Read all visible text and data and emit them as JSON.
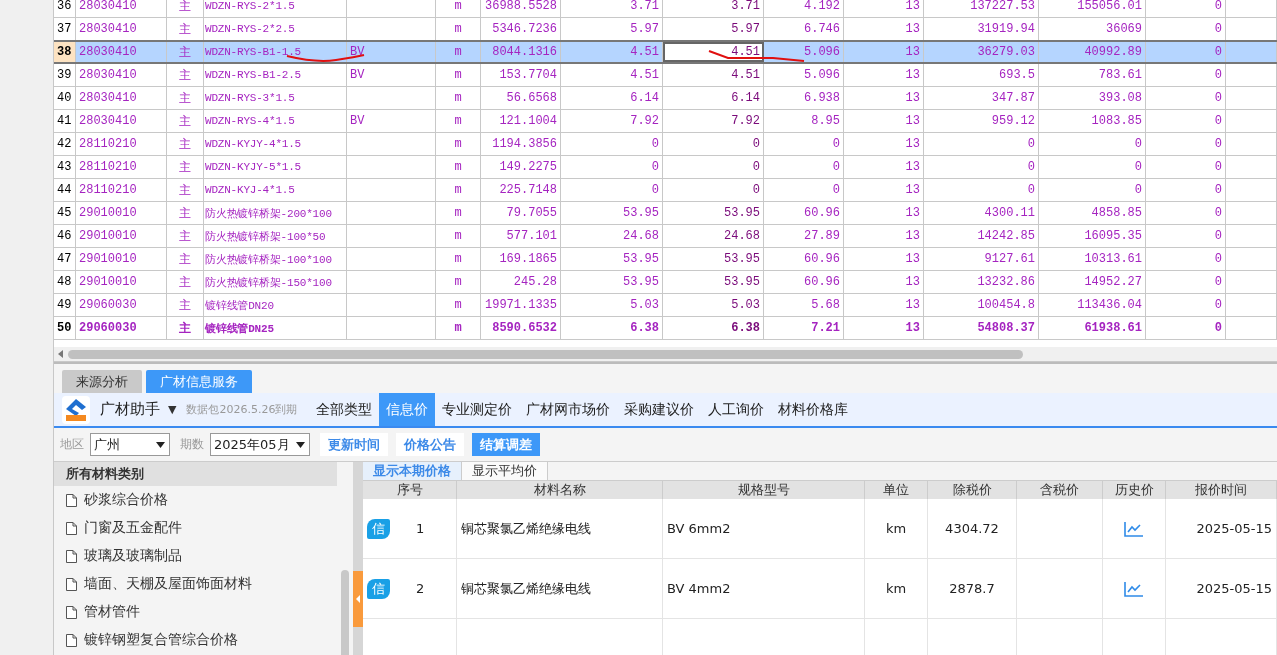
{
  "grid": {
    "rows": [
      {
        "cells": [
          "36",
          "28030410",
          "主",
          "WDZN-RYS-2*1.5",
          "",
          "m",
          "36988.5528",
          "3.71",
          "3.71",
          "4.192",
          "13",
          "137227.53",
          "155056.01",
          "0"
        ],
        "selected": false,
        "bold": false
      },
      {
        "cells": [
          "37",
          "28030410",
          "主",
          "WDZN-RYS-2*2.5",
          "",
          "m",
          "5346.7236",
          "5.97",
          "5.97",
          "6.746",
          "13",
          "31919.94",
          "36069",
          "0"
        ],
        "selected": false,
        "bold": false
      },
      {
        "cells": [
          "38",
          "28030410",
          "主",
          "WDZN-RYS-B1-1.5",
          "BV",
          "m",
          "8044.1316",
          "4.51",
          "4.51",
          "5.096",
          "13",
          "36279.03",
          "40992.89",
          "0"
        ],
        "selected": true,
        "bold": false
      },
      {
        "cells": [
          "39",
          "28030410",
          "主",
          "WDZN-RYS-B1-2.5",
          "BV",
          "m",
          "153.7704",
          "4.51",
          "4.51",
          "5.096",
          "13",
          "693.5",
          "783.61",
          "0"
        ],
        "selected": false,
        "bold": false
      },
      {
        "cells": [
          "40",
          "28030410",
          "主",
          "WDZN-RYS-3*1.5",
          "",
          "m",
          "56.6568",
          "6.14",
          "6.14",
          "6.938",
          "13",
          "347.87",
          "393.08",
          "0"
        ],
        "selected": false,
        "bold": false
      },
      {
        "cells": [
          "41",
          "28030410",
          "主",
          "WDZN-RYS-4*1.5",
          "BV",
          "m",
          "121.1004",
          "7.92",
          "7.92",
          "8.95",
          "13",
          "959.12",
          "1083.85",
          "0"
        ],
        "selected": false,
        "bold": false
      },
      {
        "cells": [
          "42",
          "28110210",
          "主",
          "WDZN-KYJY-4*1.5",
          "",
          "m",
          "1194.3856",
          "0",
          "0",
          "0",
          "13",
          "0",
          "0",
          "0"
        ],
        "selected": false,
        "bold": false
      },
      {
        "cells": [
          "43",
          "28110210",
          "主",
          "WDZN-KYJY-5*1.5",
          "",
          "m",
          "149.2275",
          "0",
          "0",
          "0",
          "13",
          "0",
          "0",
          "0"
        ],
        "selected": false,
        "bold": false
      },
      {
        "cells": [
          "44",
          "28110210",
          "主",
          "WDZN-KYJ-4*1.5",
          "",
          "m",
          "225.7148",
          "0",
          "0",
          "0",
          "13",
          "0",
          "0",
          "0"
        ],
        "selected": false,
        "bold": false
      },
      {
        "cells": [
          "45",
          "29010010",
          "主",
          "防火热镀锌桥架-200*100",
          "",
          "m",
          "79.7055",
          "53.95",
          "53.95",
          "60.96",
          "13",
          "4300.11",
          "4858.85",
          "0"
        ],
        "selected": false,
        "bold": false
      },
      {
        "cells": [
          "46",
          "29010010",
          "主",
          "防火热镀锌桥架-100*50",
          "",
          "m",
          "577.101",
          "24.68",
          "24.68",
          "27.89",
          "13",
          "14242.85",
          "16095.35",
          "0"
        ],
        "selected": false,
        "bold": false
      },
      {
        "cells": [
          "47",
          "29010010",
          "主",
          "防火热镀锌桥架-100*100",
          "",
          "m",
          "169.1865",
          "53.95",
          "53.95",
          "60.96",
          "13",
          "9127.61",
          "10313.61",
          "0"
        ],
        "selected": false,
        "bold": false
      },
      {
        "cells": [
          "48",
          "29010010",
          "主",
          "防火热镀锌桥架-150*100",
          "",
          "m",
          "245.28",
          "53.95",
          "53.95",
          "60.96",
          "13",
          "13232.86",
          "14952.27",
          "0"
        ],
        "selected": false,
        "bold": false
      },
      {
        "cells": [
          "49",
          "29060030",
          "主",
          "镀锌线管DN20",
          "",
          "m",
          "19971.1335",
          "5.03",
          "5.03",
          "5.68",
          "13",
          "100454.8",
          "113436.04",
          "0"
        ],
        "selected": false,
        "bold": false
      },
      {
        "cells": [
          "50",
          "29060030",
          "主",
          "镀锌线管DN25",
          "",
          "m",
          "8590.6532",
          "6.38",
          "6.38",
          "7.21",
          "13",
          "54808.37",
          "61938.61",
          "0"
        ],
        "selected": false,
        "bold": true
      }
    ]
  },
  "bottom_tabs": [
    {
      "label": "来源分析",
      "selected": false
    },
    {
      "label": "广材信息服务",
      "selected": true
    }
  ],
  "toolbar": {
    "title": "广材助手",
    "caret": "▼",
    "note": "数据包2026.5.26到期",
    "nav": [
      {
        "label": "全部类型",
        "selected": false
      },
      {
        "label": "信息价",
        "selected": true
      },
      {
        "label": "专业测定价",
        "selected": false
      },
      {
        "label": "广材网市场价",
        "selected": false
      },
      {
        "label": "采购建议价",
        "selected": false
      },
      {
        "label": "人工询价",
        "selected": false
      },
      {
        "label": "材料价格库",
        "selected": false
      }
    ]
  },
  "filters": {
    "region_label": "地区",
    "region": "广州",
    "period_label": "期数",
    "period": "2025年05月",
    "buttons": [
      {
        "label": "更新时间",
        "selected": false
      },
      {
        "label": "价格公告",
        "selected": false
      },
      {
        "label": "结算调差",
        "selected": true
      }
    ]
  },
  "categories": {
    "title": "所有材料类别",
    "items": [
      "砂浆综合价格",
      "门窗及五金配件",
      "玻璃及玻璃制品",
      "墙面、天棚及屋面饰面材料",
      "管材管件",
      "镀锌钢塑复合管综合价格"
    ]
  },
  "price_tabs": [
    {
      "label": "显示本期价格",
      "selected": true
    },
    {
      "label": "显示平均价",
      "selected": false
    }
  ],
  "price_table": {
    "columns": [
      "序号",
      "材料名称",
      "规格型号",
      "单位",
      "除税价",
      "含税价",
      "历史价",
      "报价时间"
    ],
    "rows": [
      {
        "badge": "信",
        "no": "1",
        "name": "铜芯聚氯乙烯绝缘电线",
        "spec": "BV 6mm2",
        "unit": "km",
        "price": "4304.72",
        "time": "2025-05-15"
      },
      {
        "badge": "信",
        "no": "2",
        "name": "铜芯聚氯乙烯绝缘电线",
        "spec": "BV 4mm2",
        "unit": "km",
        "price": "2878.7",
        "time": "2025-05-15"
      }
    ]
  }
}
